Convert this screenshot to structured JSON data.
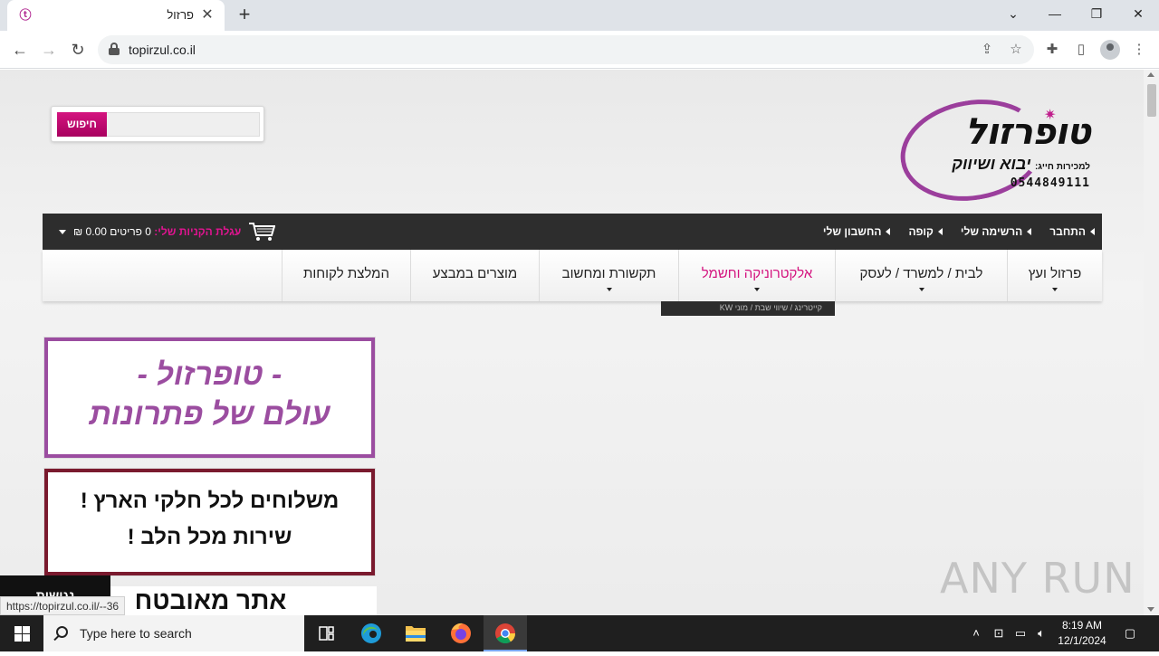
{
  "browser": {
    "tab_title": "פרזול",
    "favicon_glyph": "ⓣ",
    "close_glyph": "✕",
    "newtab_glyph": "+",
    "url": "topirzul.co.il",
    "controls": {
      "chevron": "⌄",
      "minimize": "—",
      "restore": "❐",
      "close": "✕"
    }
  },
  "header": {
    "search_button": "חיפוש",
    "logo": {
      "brand": "טופרזול",
      "sub_small": "למכירות חייג:",
      "sub_big": "יבוא ושיווק",
      "phone": "0544849111"
    }
  },
  "topbar": {
    "links": [
      "החשבון שלי",
      "קופה",
      "הרשימה שלי",
      "התחבר"
    ],
    "cart_label": "עגלת הקניות שלי:",
    "cart_items": "0 פריטים",
    "cart_total": "0.00 ₪"
  },
  "nav": {
    "items": [
      {
        "label": "פרזול ועץ",
        "dropdown": true
      },
      {
        "label": "לבית / למשרד / לעסק",
        "dropdown": true
      },
      {
        "label": "אלקטרוניקה וחשמל",
        "dropdown": true,
        "active": true
      },
      {
        "label": "תקשורת ומחשוב",
        "dropdown": true
      },
      {
        "label": "מוצרים במבצע",
        "dropdown": false
      },
      {
        "label": "המלצת לקוחות",
        "dropdown": false
      }
    ],
    "submenu_peek": "קייטרינג / שיווי שבת / מוני KW"
  },
  "banners": {
    "b1_line1": "- טופרזול -",
    "b1_line2": "עולם של פתרונות",
    "b2_line1": "משלוחים לכל חלקי הארץ !",
    "b2_line2": "שירות מכל הלב !",
    "b3_line1": "אתר מאובטח"
  },
  "floating_tab": "נגישות",
  "status_link": "https://topirzul.co.il/--36",
  "watermark": "ANY RUN",
  "taskbar": {
    "search_placeholder": "Type here to search",
    "time": "8:19 AM",
    "date": "12/1/2024"
  },
  "colors": {
    "accent": "#d4147f",
    "brand_purple": "#9b4da0",
    "dark_bar": "#2d2d2d",
    "banner2_border": "#7a1a2e"
  }
}
